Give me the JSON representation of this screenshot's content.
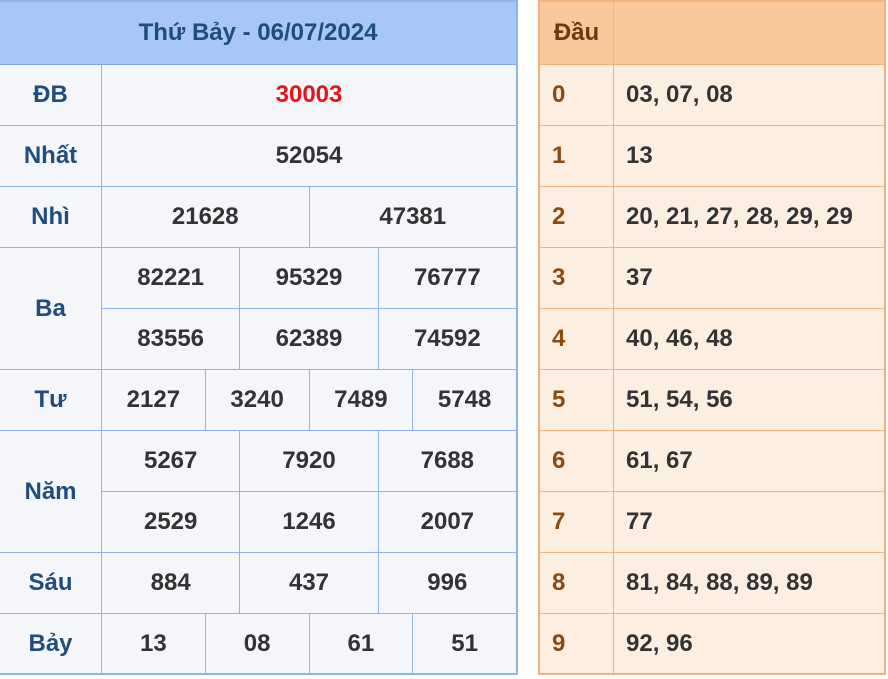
{
  "results": {
    "title": "Thứ Bảy - 06/07/2024",
    "prizes": [
      {
        "label": "ĐB",
        "lines": [
          [
            "30003"
          ]
        ]
      },
      {
        "label": "Nhất",
        "lines": [
          [
            "52054"
          ]
        ]
      },
      {
        "label": "Nhì",
        "lines": [
          [
            "21628",
            "47381"
          ]
        ]
      },
      {
        "label": "Ba",
        "lines": [
          [
            "82221",
            "95329",
            "76777"
          ],
          [
            "83556",
            "62389",
            "74592"
          ]
        ]
      },
      {
        "label": "Tư",
        "lines": [
          [
            "2127",
            "3240",
            "7489",
            "5748"
          ]
        ]
      },
      {
        "label": "Năm",
        "lines": [
          [
            "5267",
            "7920",
            "7688"
          ],
          [
            "2529",
            "1246",
            "2007"
          ]
        ]
      },
      {
        "label": "Sáu",
        "lines": [
          [
            "884",
            "437",
            "996"
          ]
        ]
      },
      {
        "label": "Bảy",
        "lines": [
          [
            "13",
            "08",
            "61",
            "51"
          ]
        ]
      }
    ]
  },
  "dau": {
    "header_label": "Đầu",
    "rows": [
      {
        "digit": "0",
        "values": "03, 07, 08"
      },
      {
        "digit": "1",
        "values": "13"
      },
      {
        "digit": "2",
        "values": "20, 21, 27, 28, 29, 29"
      },
      {
        "digit": "3",
        "values": "37"
      },
      {
        "digit": "4",
        "values": "40, 46, 48"
      },
      {
        "digit": "5",
        "values": "51, 54, 56"
      },
      {
        "digit": "6",
        "values": "61, 67"
      },
      {
        "digit": "7",
        "values": "77"
      },
      {
        "digit": "8",
        "values": "81, 84, 88, 89, 89"
      },
      {
        "digit": "9",
        "values": "92, 96"
      }
    ]
  },
  "colors": {
    "special_prize": "#e3141b",
    "results_header_bg": "#a8c6f6",
    "dau_header_bg": "#f9c99c"
  }
}
